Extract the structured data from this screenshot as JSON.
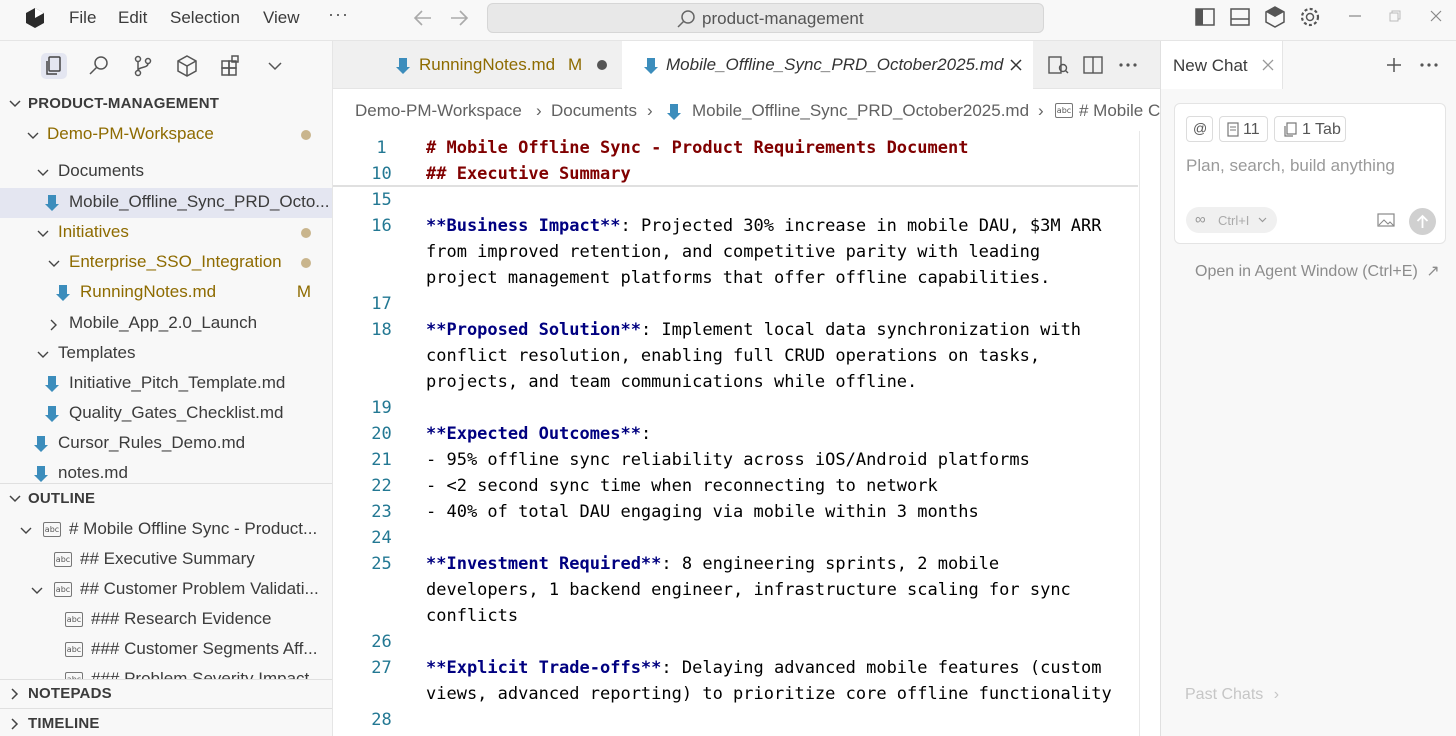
{
  "titlebar": {
    "menu": [
      "File",
      "Edit",
      "Selection",
      "View"
    ],
    "more": "···",
    "search_text": "product-management"
  },
  "sidebar": {
    "explorer_title": "PRODUCT-MANAGEMENT",
    "tree": [
      {
        "label": "Demo-PM-Workspace",
        "type": "folder-open",
        "level": 1,
        "status": "dot",
        "color": "yellow"
      },
      {
        "label": "Documents",
        "type": "folder-open",
        "level": 2
      },
      {
        "label": "Mobile_Offline_Sync_PRD_Octo...",
        "type": "file",
        "level": 3,
        "selected": true
      },
      {
        "label": "Initiatives",
        "type": "folder-open",
        "level": 2,
        "status": "dot",
        "color": "yellow"
      },
      {
        "label": "Enterprise_SSO_Integration",
        "type": "folder-open",
        "level": 3,
        "status": "dot",
        "color": "yellow"
      },
      {
        "label": "RunningNotes.md",
        "type": "file",
        "level": 4,
        "status": "M",
        "color": "yellow"
      },
      {
        "label": "Mobile_App_2.0_Launch",
        "type": "folder-closed",
        "level": 3
      },
      {
        "label": "Templates",
        "type": "folder-open",
        "level": 2
      },
      {
        "label": "Initiative_Pitch_Template.md",
        "type": "file",
        "level": 3
      },
      {
        "label": "Quality_Gates_Checklist.md",
        "type": "file",
        "level": 3
      },
      {
        "label": "Cursor_Rules_Demo.md",
        "type": "file",
        "level": 2
      },
      {
        "label": "notes.md",
        "type": "file",
        "level": 2
      }
    ],
    "outline_title": "OUTLINE",
    "outline": [
      {
        "label": "# Mobile Offline Sync - Product...",
        "level": 1,
        "chevron": true
      },
      {
        "label": "## Executive Summary",
        "level": 2,
        "chevron": false
      },
      {
        "label": "## Customer Problem Validati...",
        "level": 2,
        "chevron": true
      },
      {
        "label": "### Research Evidence",
        "level": 3,
        "chevron": false
      },
      {
        "label": "### Customer Segments Aff...",
        "level": 3,
        "chevron": false
      },
      {
        "label": "### Problem Severity Impact",
        "level": 3,
        "chevron": false
      }
    ],
    "notepads_title": "NOTEPADS",
    "timeline_title": "TIMELINE"
  },
  "editor": {
    "tabs": [
      {
        "label": "RunningNotes.md",
        "modified": "M",
        "active": false
      },
      {
        "label": "Mobile_Offline_Sync_PRD_October2025.md",
        "active": true
      }
    ],
    "breadcrumbs": [
      "Demo-PM-Workspace",
      "Documents",
      "Mobile_Offline_Sync_PRD_October2025.md",
      "# Mobile C"
    ],
    "lines": [
      {
        "n": "1",
        "parts": [
          {
            "t": "# Mobile Offline Sync - Product Requirements Document",
            "c": "hdr"
          }
        ]
      },
      {
        "n": "10",
        "parts": [
          {
            "t": "## Executive Summary",
            "c": "hdr"
          }
        ]
      },
      {
        "n": "15",
        "parts": []
      },
      {
        "n": "16",
        "parts": [
          {
            "t": "**Business Impact**",
            "c": "bold"
          },
          {
            "t": ": Projected 30% increase in mobile DAU, $3M ARR",
            "c": ""
          }
        ]
      },
      {
        "n": "",
        "parts": [
          {
            "t": "from improved retention, and competitive parity with leading",
            "c": ""
          }
        ]
      },
      {
        "n": "",
        "parts": [
          {
            "t": "project management platforms that offer offline capabilities.",
            "c": ""
          }
        ]
      },
      {
        "n": "17",
        "parts": []
      },
      {
        "n": "18",
        "parts": [
          {
            "t": "**Proposed Solution**",
            "c": "bold"
          },
          {
            "t": ": Implement local data synchronization with",
            "c": ""
          }
        ]
      },
      {
        "n": "",
        "parts": [
          {
            "t": "conflict resolution, enabling full CRUD operations on tasks,",
            "c": ""
          }
        ]
      },
      {
        "n": "",
        "parts": [
          {
            "t": "projects, and team communications while offline.",
            "c": ""
          }
        ]
      },
      {
        "n": "19",
        "parts": []
      },
      {
        "n": "20",
        "parts": [
          {
            "t": "**Expected Outcomes**",
            "c": "bold"
          },
          {
            "t": ":",
            "c": ""
          }
        ]
      },
      {
        "n": "21",
        "parts": [
          {
            "t": "- 95% offline sync reliability across iOS/Android platforms",
            "c": ""
          }
        ]
      },
      {
        "n": "22",
        "parts": [
          {
            "t": "- <2 second sync time when reconnecting to network",
            "c": ""
          }
        ]
      },
      {
        "n": "23",
        "parts": [
          {
            "t": "- 40% of total DAU engaging via mobile within 3 months",
            "c": ""
          }
        ]
      },
      {
        "n": "24",
        "parts": []
      },
      {
        "n": "25",
        "parts": [
          {
            "t": "**Investment Required**",
            "c": "bold"
          },
          {
            "t": ": 8 engineering sprints, 2 mobile",
            "c": ""
          }
        ]
      },
      {
        "n": "",
        "parts": [
          {
            "t": "developers, 1 backend engineer, infrastructure scaling for sync",
            "c": ""
          }
        ]
      },
      {
        "n": "",
        "parts": [
          {
            "t": "conflicts",
            "c": ""
          }
        ]
      },
      {
        "n": "26",
        "parts": []
      },
      {
        "n": "27",
        "parts": [
          {
            "t": "**Explicit Trade-offs**",
            "c": "bold"
          },
          {
            "t": ": Delaying advanced mobile features (custom",
            "c": ""
          }
        ]
      },
      {
        "n": "",
        "parts": [
          {
            "t": "views, advanced reporting) to prioritize core offline functionality",
            "c": ""
          }
        ]
      },
      {
        "n": "28",
        "parts": []
      }
    ]
  },
  "chat": {
    "tab_label": "New Chat",
    "context_count": "11",
    "tab_count": "1 Tab",
    "placeholder": "Plan, search, build anything",
    "mode_label": "Ctrl+I",
    "open_agent": "Open in Agent Window (Ctrl+E)",
    "past_chats": "Past Chats"
  },
  "colors": {
    "header": "#800000",
    "bold": "#000080",
    "line_number": "#237893",
    "modified": "#8e6b00",
    "md_icon": "#3c8dbc"
  }
}
